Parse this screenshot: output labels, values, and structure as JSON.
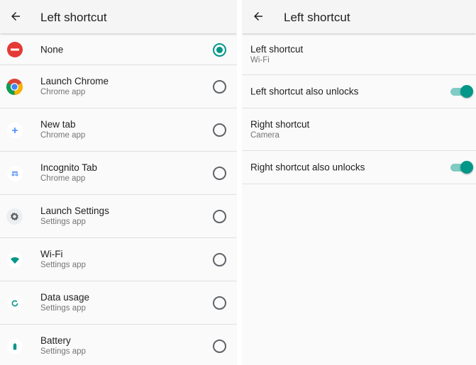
{
  "left_screen": {
    "title": "Left shortcut",
    "back_icon": "arrow-back-icon",
    "options": [
      {
        "label": "None",
        "sublabel": "",
        "icon": "remove-circle-icon",
        "selected": true
      },
      {
        "label": "Launch Chrome",
        "sublabel": "Chrome app",
        "icon": "chrome-icon",
        "selected": false
      },
      {
        "label": "New tab",
        "sublabel": "Chrome app",
        "icon": "plus-icon",
        "selected": false
      },
      {
        "label": "Incognito Tab",
        "sublabel": "Chrome app",
        "icon": "incognito-icon",
        "selected": false
      },
      {
        "label": "Launch Settings",
        "sublabel": "Settings app",
        "icon": "settings-gear-icon",
        "selected": false
      },
      {
        "label": "Wi-Fi",
        "sublabel": "Settings app",
        "icon": "wifi-icon",
        "selected": false
      },
      {
        "label": "Data usage",
        "sublabel": "Settings app",
        "icon": "data-usage-icon",
        "selected": false
      },
      {
        "label": "Battery",
        "sublabel": "Settings app",
        "icon": "battery-icon",
        "selected": false
      }
    ]
  },
  "right_screen": {
    "title": "Left shortcut",
    "back_icon": "arrow-back-icon",
    "settings": [
      {
        "label": "Left shortcut",
        "value": "Wi-Fi"
      },
      {
        "label": "Left shortcut also unlocks",
        "toggle_on": true
      },
      {
        "label": "Right shortcut",
        "value": "Camera"
      },
      {
        "label": "Right shortcut also unlocks",
        "toggle_on": true
      }
    ]
  },
  "colors": {
    "accent": "#009688",
    "accent_light": "#80cbc4",
    "none_red": "#e53935",
    "icon_teal": "#009688",
    "settings_gray": "#5f6368"
  }
}
